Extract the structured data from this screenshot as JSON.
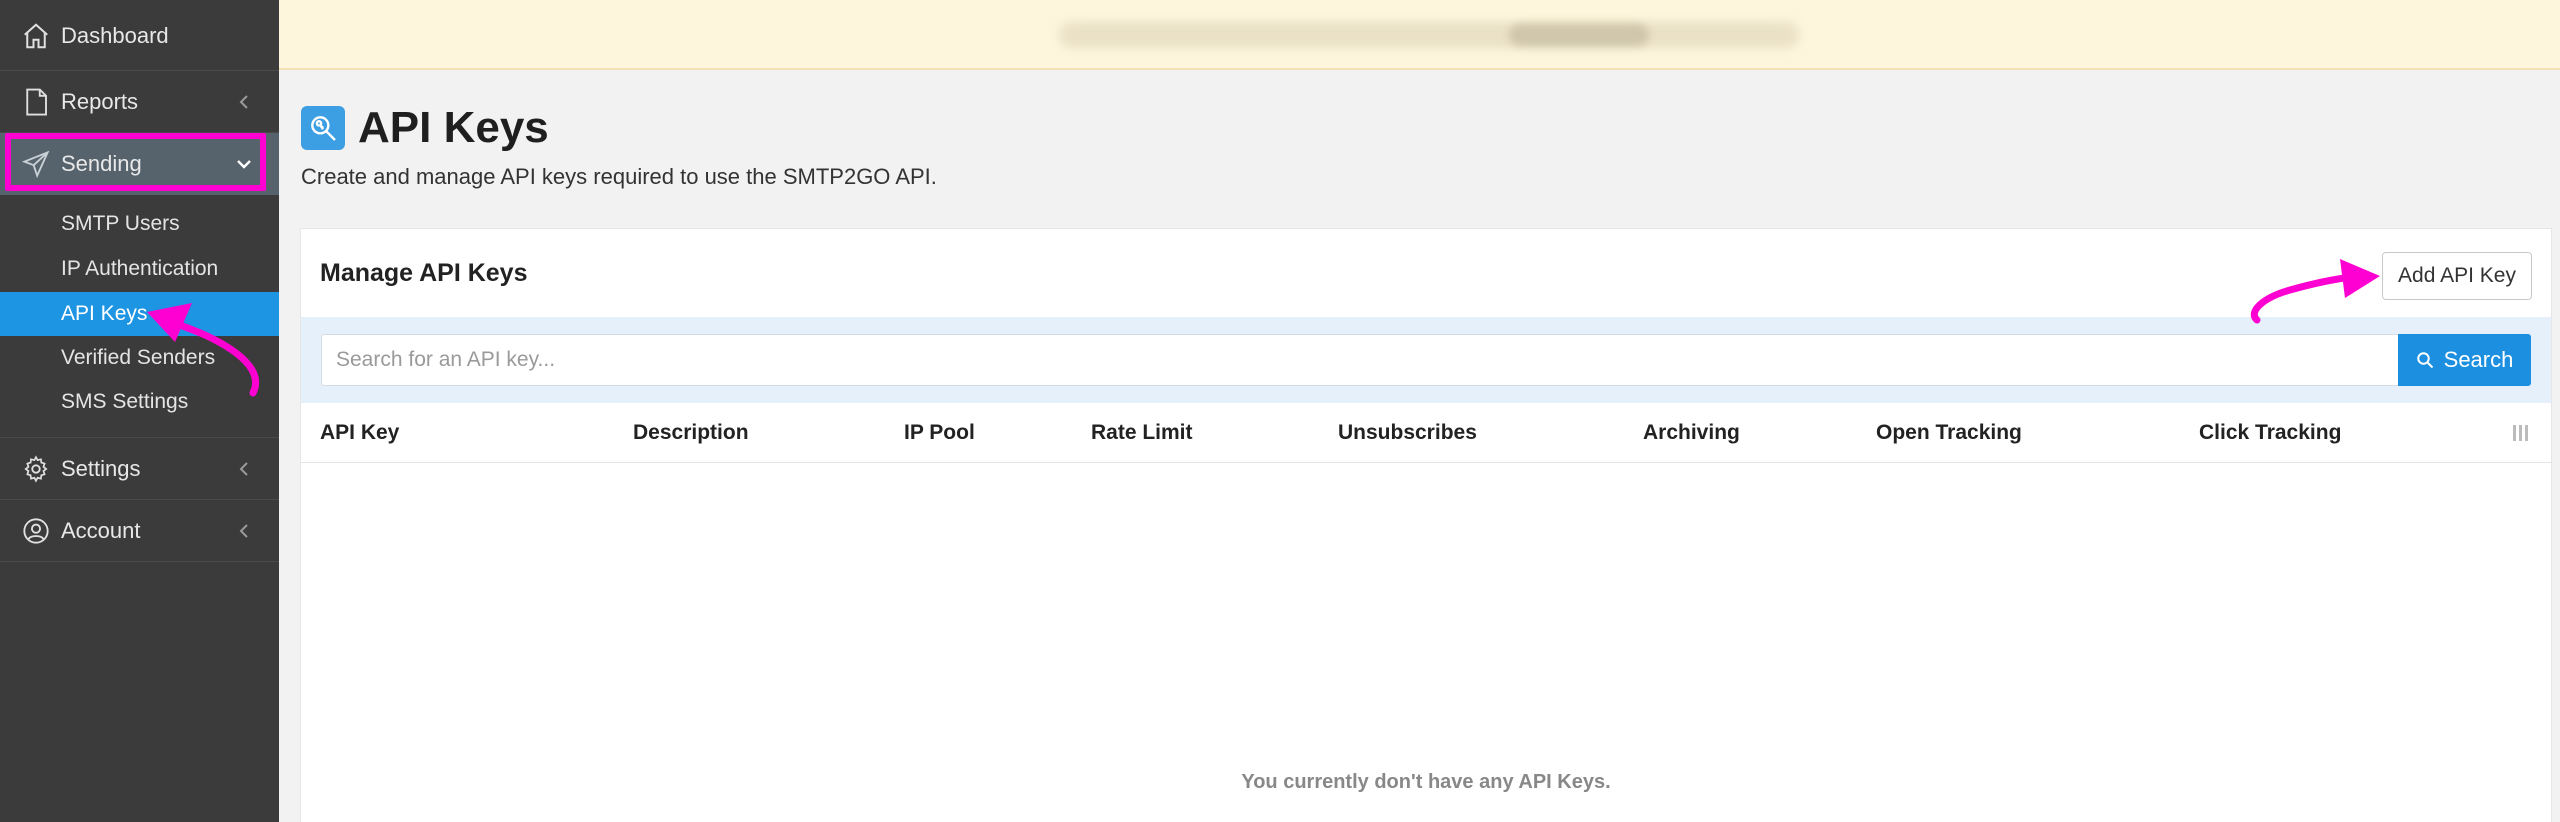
{
  "sidebar": {
    "items": [
      {
        "label": "Dashboard",
        "icon": "home-icon"
      },
      {
        "label": "Reports",
        "icon": "document-icon"
      },
      {
        "label": "Sending",
        "icon": "paper-plane-icon"
      },
      {
        "label": "Settings",
        "icon": "gear-icon"
      },
      {
        "label": "Account",
        "icon": "user-circle-icon"
      }
    ],
    "sending_sub": [
      {
        "label": "SMTP Users"
      },
      {
        "label": "IP Authentication"
      },
      {
        "label": "API Keys"
      },
      {
        "label": "Verified Senders"
      },
      {
        "label": "SMS Settings"
      }
    ]
  },
  "header": {
    "title": "API Keys",
    "subtitle": "Create and manage API keys required to use the SMTP2GO API."
  },
  "card": {
    "title": "Manage API Keys",
    "add_button": "Add API Key",
    "search_placeholder": "Search for an API key...",
    "search_button": "Search",
    "columns": [
      "API Key",
      "Description",
      "IP Pool",
      "Rate Limit",
      "Unsubscribes",
      "Archiving",
      "Open Tracking",
      "Click Tracking"
    ],
    "empty_message": "You currently don't have any API Keys."
  },
  "colors": {
    "sidebar_bg": "#3b3b3b",
    "active_item": "#1d95e3",
    "annotation": "#ff00d2",
    "primary_button": "#1d8fe0",
    "banner": "#fdf5dc"
  }
}
